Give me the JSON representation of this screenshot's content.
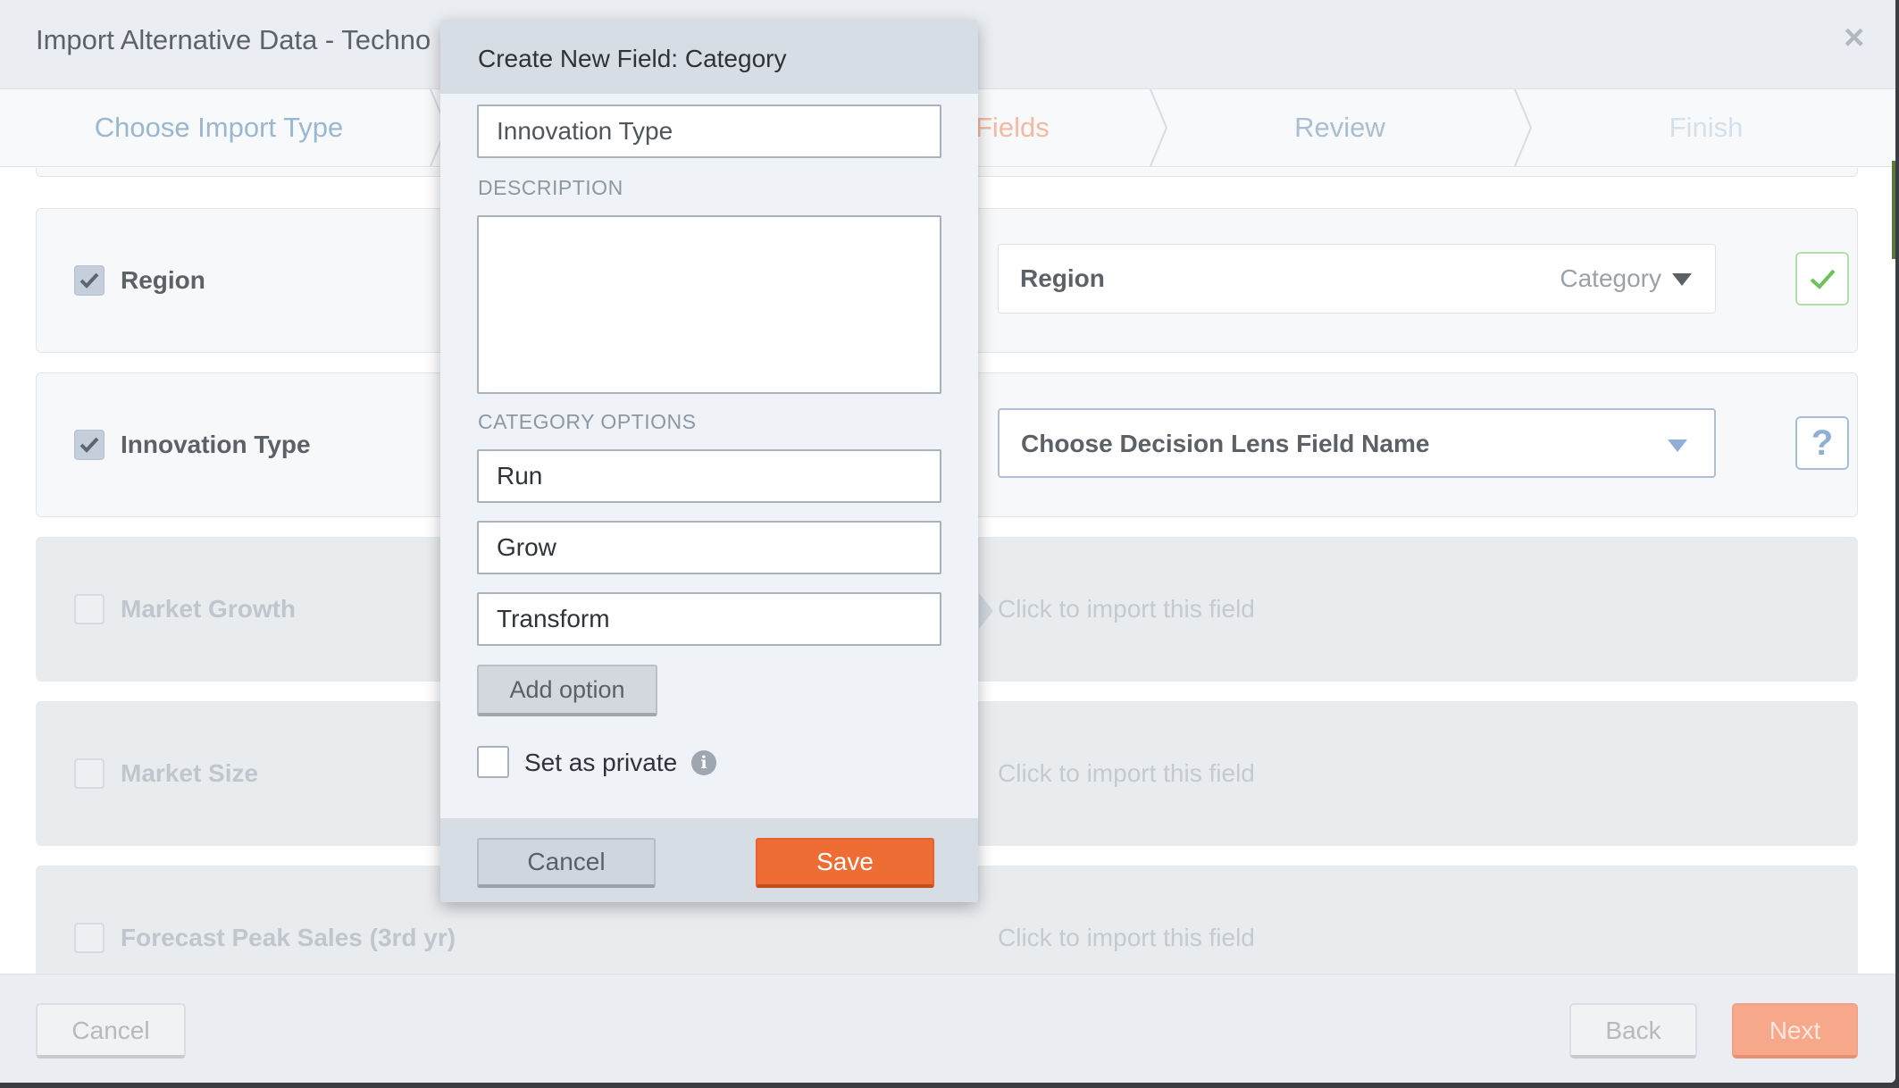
{
  "wizard": {
    "title": "Import Alternative Data - Techno",
    "close_glyph": "×",
    "steps": [
      "Choose Import Type",
      "Fields",
      "Review",
      "Finish"
    ]
  },
  "rows": [
    {
      "label": "Region",
      "checked": true,
      "field_name": "Region",
      "field_type": "Category",
      "status": "ok"
    },
    {
      "label": "Innovation Type",
      "checked": true,
      "field_placeholder": "Choose Decision Lens Field Name",
      "status": "?"
    },
    {
      "label": "Market Growth",
      "checked": false,
      "hint": "Click to import this field"
    },
    {
      "label": "Market Size",
      "checked": false,
      "hint": "Click to import this field"
    },
    {
      "label": "Forecast Peak Sales (3rd yr)",
      "checked": false,
      "hint": "Click to import this field"
    }
  ],
  "footer": {
    "cancel": "Cancel",
    "back": "Back",
    "next": "Next"
  },
  "dialog": {
    "title": "Create New Field: Category",
    "name_value": "Innovation Type",
    "description_label": "DESCRIPTION",
    "description_value": "",
    "category_options_label": "CATEGORY OPTIONS",
    "options": [
      "Run",
      "Grow",
      "Transform"
    ],
    "add_option": "Add option",
    "private_label": "Set as private",
    "info_glyph": "i",
    "cancel": "Cancel",
    "save": "Save"
  },
  "colors": {
    "accent": "#ee6d35",
    "check_ok": "#6cc15a",
    "link_blue": "#8fb0d3"
  }
}
